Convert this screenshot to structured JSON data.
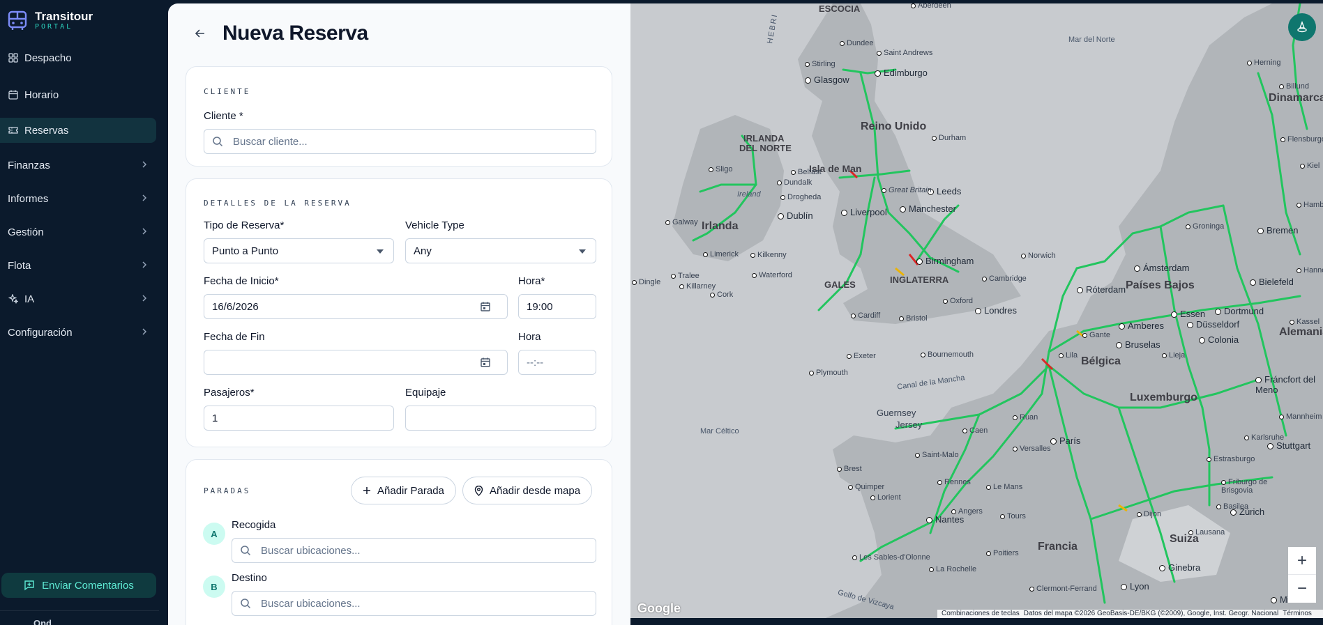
{
  "brand": {
    "name": "Transitour",
    "sub": "PORTAL"
  },
  "nav": [
    {
      "label": "Despacho",
      "icon": "grid-icon",
      "expandable": false,
      "active": false
    },
    {
      "label": "Horario",
      "icon": "calendar-icon",
      "expandable": false,
      "active": false
    },
    {
      "label": "Reservas",
      "icon": "ticket-icon",
      "expandable": false,
      "active": true
    },
    {
      "label": "Finanzas",
      "icon": "",
      "expandable": true,
      "active": false
    },
    {
      "label": "Informes",
      "icon": "",
      "expandable": true,
      "active": false
    },
    {
      "label": "Gestión",
      "icon": "",
      "expandable": true,
      "active": false
    },
    {
      "label": "Flota",
      "icon": "",
      "expandable": true,
      "active": false
    },
    {
      "label": "IA",
      "icon": "sparkle-icon",
      "expandable": true,
      "active": false
    },
    {
      "label": "Configuración",
      "icon": "",
      "expandable": true,
      "active": false
    }
  ],
  "feedback_label": "Enviar Comentarios",
  "user_stub": "Ond...",
  "page": {
    "title": "Nueva Reserva"
  },
  "cliente": {
    "section": "CLIENTE",
    "label": "Cliente *",
    "placeholder": "Buscar cliente..."
  },
  "detalles": {
    "section": "DETALLES DE LA RESERVA",
    "tipo_label": "Tipo de Reserva*",
    "tipo_value": "Punto a Punto",
    "vehicle_label": "Vehicle Type",
    "vehicle_value": "Any",
    "fecha_inicio_label": "Fecha de Inicio*",
    "fecha_inicio_value": "16/6/2026",
    "hora_inicio_label": "Hora*",
    "hora_inicio_value": "19:00",
    "fecha_fin_label": "Fecha de Fin",
    "fecha_fin_value": "",
    "hora_fin_label": "Hora",
    "hora_fin_value": "--:--",
    "pasajeros_label": "Pasajeros*",
    "pasajeros_value": "1",
    "equipaje_label": "Equipaje",
    "equipaje_value": ""
  },
  "paradas": {
    "section": "PARADAS",
    "add_stop": "Añadir Parada",
    "add_from_map": "Añadir desde mapa",
    "stops": [
      {
        "badge": "A",
        "label": "Recogida",
        "placeholder": "Buscar ubicaciones..."
      },
      {
        "badge": "B",
        "label": "Destino",
        "placeholder": "Buscar ubicaciones..."
      }
    ]
  },
  "map": {
    "countries": [
      {
        "text": "ESCOCIA"
      },
      {
        "text": "Reino Unido"
      },
      {
        "text": "IRLANDA"
      },
      {
        "text": "DEL NORTE"
      },
      {
        "text": "Irlanda"
      },
      {
        "text": "Isla de Man"
      },
      {
        "text": "INGLATERRA"
      },
      {
        "text": "GALES"
      },
      {
        "text": "Países Bajos"
      },
      {
        "text": "Bélgica"
      },
      {
        "text": "Luxemburgo"
      },
      {
        "text": "Francia"
      },
      {
        "text": "Suiza"
      },
      {
        "text": "Dinamarca"
      },
      {
        "text": "Alemania"
      },
      {
        "text": "Guernsey"
      },
      {
        "text": "Jersey"
      }
    ],
    "seas": [
      {
        "text": "Mar del Norte"
      },
      {
        "text": "Mar Céltico"
      },
      {
        "text": "Canal de la Mancha"
      },
      {
        "text": "Golfo de Vizcaya"
      },
      {
        "text": "HEBRI"
      }
    ],
    "cities": [
      "Edimburgo",
      "Glasgow",
      "Manchester",
      "Leeds",
      "Liverpool",
      "Birmingham",
      "Londres",
      "Dublín",
      "Ámsterdam",
      "Róterdam",
      "Amberes",
      "Bruselas",
      "París",
      "Nantes",
      "Lyon",
      "Dortmund",
      "Essen",
      "Düsseldorf",
      "Colonia",
      "Bielefeld",
      "Bremen",
      "Stuttgart",
      "Zúrich",
      "Ginebra",
      "Milán",
      "Fráncfort del Meno"
    ],
    "small_cities": [
      "Aberdeen",
      "Dundee",
      "Saint Andrews",
      "Stirling",
      "Durham",
      "Great Britain",
      "Belfast",
      "Dundalk",
      "Drogheda",
      "Sligo",
      "Galway",
      "Limerick",
      "Kilkenny",
      "Waterford",
      "Cork",
      "Tralee",
      "Killarney",
      "Dingle",
      "Ireland",
      "Norwich",
      "Cambridge",
      "Oxford",
      "Cardiff",
      "Bristol",
      "Exeter",
      "Plymouth",
      "Bournemouth",
      "Groninga",
      "Hannover",
      "Kassel",
      "Mannheim",
      "Karlsruhe",
      "Estrasburgo",
      "Friburgo de Brisgovia",
      "Basilea",
      "Lausana",
      "Dijon",
      "Ruan",
      "Caen",
      "Versalles",
      "Saint-Malo",
      "Brest",
      "Quimper",
      "Lorient",
      "Rennes",
      "Le Mans",
      "Angers",
      "Tours",
      "Poitiers",
      "Les Sables-d'Olonne",
      "La Rochelle",
      "Clermont-Ferrand",
      "Herning",
      "Billund",
      "Flensburgo",
      "Kiel",
      "Hamburgo",
      "Lieja",
      "Lila",
      "Gante"
    ],
    "google": "Google",
    "attribution": [
      "Combinaciones de teclas",
      "Datos del mapa ©2026 GeoBasis-DE/BKG (©2009), Google, Inst. Geogr. Nacional",
      "Términos"
    ],
    "zoom_in": "+",
    "zoom_out": "−"
  },
  "colors": {
    "sidebar_bg": "#0b1a2c",
    "accent": "#2dd4bf",
    "traffic_green": "#22c55e",
    "traffic_red": "#dc2626",
    "traffic_yellow": "#eab308",
    "land": "#b5b9bd",
    "water": "#c8cbcf"
  }
}
